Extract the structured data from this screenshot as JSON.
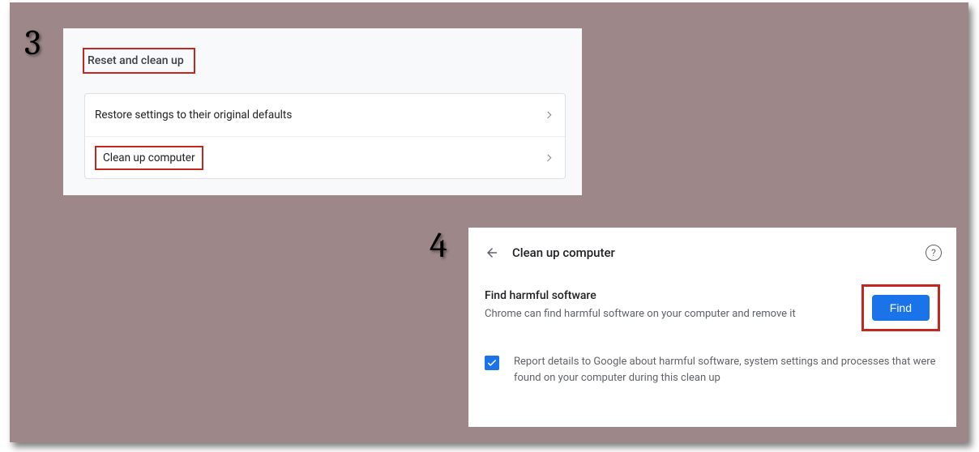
{
  "steps": {
    "three": "3",
    "four": "4"
  },
  "panel3": {
    "title": "Reset and clean up",
    "rows": [
      {
        "label": "Restore settings to their original defaults"
      },
      {
        "label": "Clean up computer"
      }
    ]
  },
  "panel4": {
    "title": "Clean up computer",
    "find": {
      "heading": "Find harmful software",
      "desc": "Chrome can find harmful software on your computer and remove it",
      "button": "Find"
    },
    "report": {
      "checked": true,
      "text": "Report details to Google about harmful software, system settings and processes that were found on your computer during this clean up"
    },
    "help_glyph": "?"
  }
}
